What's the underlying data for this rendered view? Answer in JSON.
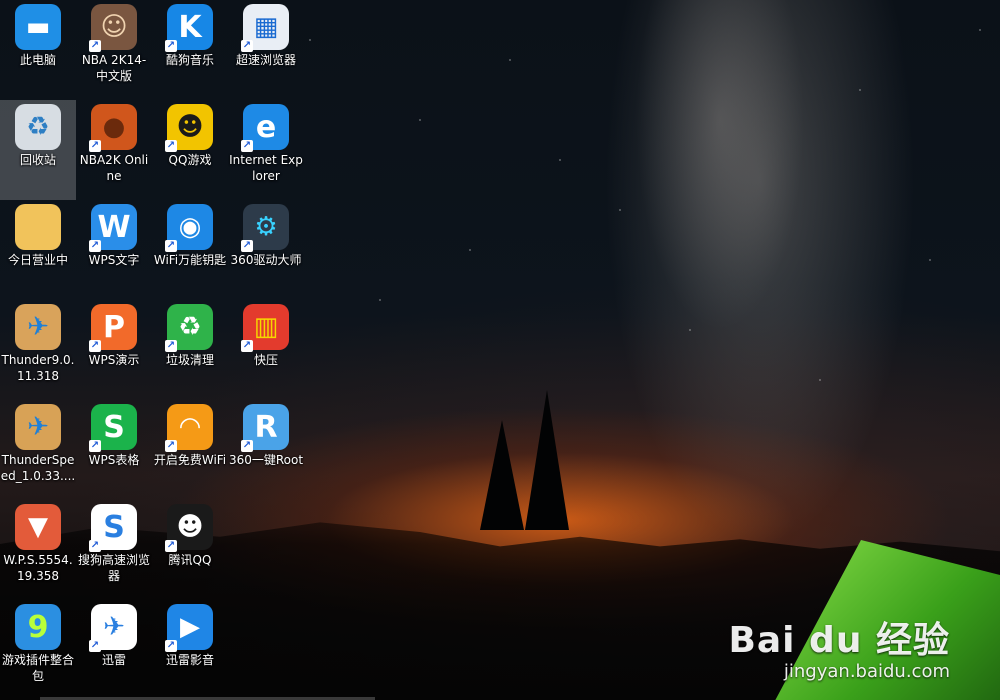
{
  "desktop": {
    "icons": [
      {
        "label": "此电脑",
        "icon": "computer-icon",
        "shortcut": false,
        "selected": false,
        "bg": "#1f8fe6",
        "glyph": "▬",
        "fg": "#ffffff"
      },
      {
        "label": "回收站",
        "icon": "recycle-bin-icon",
        "shortcut": false,
        "selected": true,
        "bg": "#d7dde3",
        "glyph": "♻",
        "fg": "#2e7fc4"
      },
      {
        "label": "今日营业中",
        "icon": "folder-icon",
        "shortcut": false,
        "selected": false,
        "bg": "#f1c35b",
        "glyph": "",
        "fg": "#ffffff"
      },
      {
        "label": "Thunder9.0.11.318",
        "icon": "thunder-box-icon",
        "shortcut": false,
        "selected": false,
        "bg": "#d9a35b",
        "glyph": "✈",
        "fg": "#1f7fd6"
      },
      {
        "label": "ThunderSpeed_1.0.33....",
        "icon": "thunder-speed-icon",
        "shortcut": false,
        "selected": false,
        "bg": "#d8a256",
        "glyph": "✈",
        "fg": "#1f7fd6"
      },
      {
        "label": "W.P.S.5554.19.358",
        "icon": "wps-package-icon",
        "shortcut": false,
        "selected": false,
        "bg": "#e35b3a",
        "glyph": "▼",
        "fg": "#ffffff"
      },
      {
        "label": "游戏插件整合包",
        "icon": "game-plugin-icon",
        "shortcut": false,
        "selected": false,
        "bg": "#2b8fe1",
        "glyph": "9",
        "fg": "#b8ff3a"
      },
      {
        "label": "NBA 2K14-中文版",
        "icon": "nba-player-icon",
        "shortcut": true,
        "selected": false,
        "bg": "#7a5640",
        "glyph": "☺",
        "fg": "#f0d3b0"
      },
      {
        "label": "NBA2K Online",
        "icon": "basketball-icon",
        "shortcut": true,
        "selected": false,
        "bg": "#d0561c",
        "glyph": "●",
        "fg": "#6b2a0c"
      },
      {
        "label": "WPS文字",
        "icon": "wps-writer-icon",
        "shortcut": true,
        "selected": false,
        "bg": "#2a8ee9",
        "glyph": "W",
        "fg": "#ffffff"
      },
      {
        "label": "WPS演示",
        "icon": "wps-presentation-icon",
        "shortcut": true,
        "selected": false,
        "bg": "#f26a2a",
        "glyph": "P",
        "fg": "#ffffff"
      },
      {
        "label": "WPS表格",
        "icon": "wps-spreadsheet-icon",
        "shortcut": true,
        "selected": false,
        "bg": "#1bb34b",
        "glyph": "S",
        "fg": "#ffffff"
      },
      {
        "label": "搜狗高速浏览器",
        "icon": "sogou-browser-icon",
        "shortcut": true,
        "selected": false,
        "bg": "#ffffff",
        "glyph": "S",
        "fg": "#2a7fe0"
      },
      {
        "label": "迅雷",
        "icon": "xunlei-icon",
        "shortcut": true,
        "selected": false,
        "bg": "#ffffff",
        "glyph": "✈",
        "fg": "#2a7fe0"
      },
      {
        "label": "酷狗音乐",
        "icon": "kugou-music-icon",
        "shortcut": true,
        "selected": false,
        "bg": "#1787e6",
        "glyph": "K",
        "fg": "#ffffff"
      },
      {
        "label": "QQ游戏",
        "icon": "qq-game-icon",
        "shortcut": true,
        "selected": false,
        "bg": "#f2c400",
        "glyph": "☻",
        "fg": "#1a1a1a"
      },
      {
        "label": "WiFi万能钥匙",
        "icon": "wifi-key-icon",
        "shortcut": true,
        "selected": false,
        "bg": "#1e88e5",
        "glyph": "◉",
        "fg": "#ffffff"
      },
      {
        "label": "垃圾清理",
        "icon": "trash-clean-icon",
        "shortcut": true,
        "selected": false,
        "bg": "#2fb34a",
        "glyph": "♻",
        "fg": "#ffffff"
      },
      {
        "label": "开启免费WiFi",
        "icon": "free-wifi-icon",
        "shortcut": true,
        "selected": false,
        "bg": "#f59a16",
        "glyph": "◠",
        "fg": "#ffffff"
      },
      {
        "label": "腾讯QQ",
        "icon": "qq-penguin-icon",
        "shortcut": true,
        "selected": false,
        "bg": "#1a1a1a",
        "glyph": "☻",
        "fg": "#ffffff"
      },
      {
        "label": "迅雷影音",
        "icon": "xunlei-player-icon",
        "shortcut": true,
        "selected": false,
        "bg": "#1f86e6",
        "glyph": "▶",
        "fg": "#ffffff"
      },
      {
        "label": "超速浏览器",
        "icon": "browser-window-icon",
        "shortcut": true,
        "selected": false,
        "bg": "#e9eef5",
        "glyph": "▦",
        "fg": "#1a6ad1"
      },
      {
        "label": "Internet Explorer",
        "icon": "internet-explorer-icon",
        "shortcut": true,
        "selected": false,
        "bg": "#1e8ae6",
        "glyph": "e",
        "fg": "#ffffff"
      },
      {
        "label": "360驱动大师",
        "icon": "driver-master-icon",
        "shortcut": true,
        "selected": false,
        "bg": "#2d3b4a",
        "glyph": "⚙",
        "fg": "#39d2ff"
      },
      {
        "label": "快压",
        "icon": "kuaiya-icon",
        "shortcut": true,
        "selected": false,
        "bg": "#e33b2d",
        "glyph": "▥",
        "fg": "#f6d700"
      },
      {
        "label": "360一键Root",
        "icon": "root-360-icon",
        "shortcut": true,
        "selected": false,
        "bg": "#4aa3e8",
        "glyph": "R",
        "fg": "#ffffff"
      }
    ]
  },
  "watermark": {
    "logo": "Bai du 经验",
    "url": "jingyan.baidu.com"
  }
}
